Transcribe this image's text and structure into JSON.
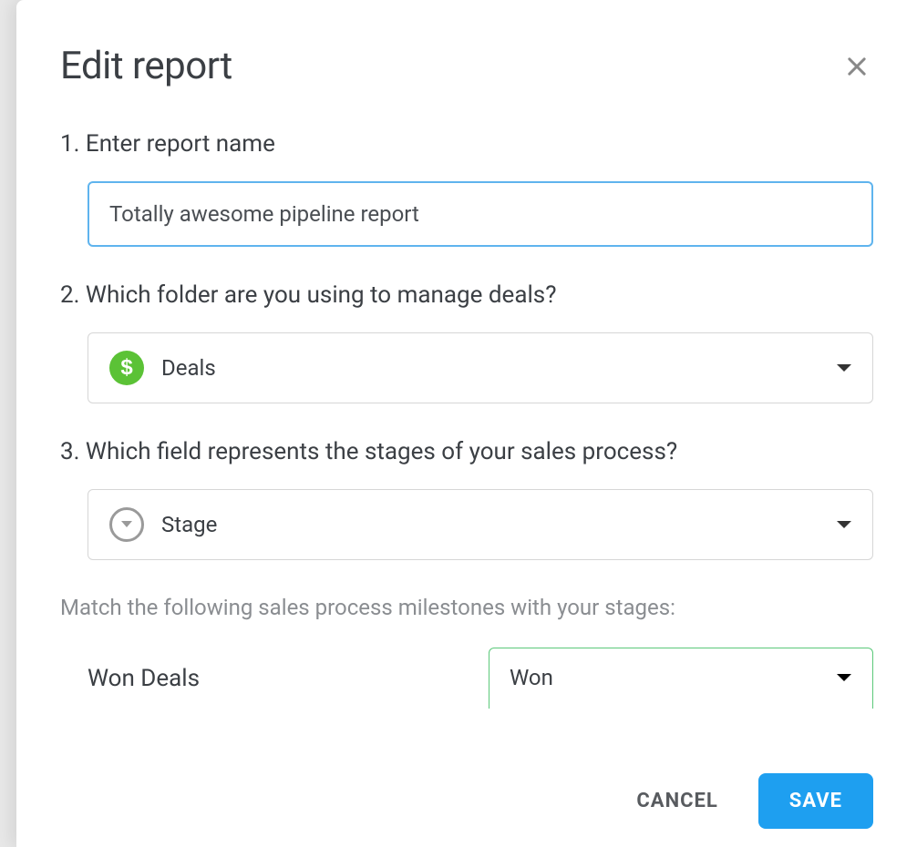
{
  "dialog": {
    "title": "Edit report"
  },
  "step1": {
    "label": "1. Enter report name",
    "input_value": "Totally awesome pipeline report"
  },
  "step2": {
    "label": "2. Which folder are you using to manage deals?",
    "selected": "Deals",
    "icon": "dollar-icon"
  },
  "step3": {
    "label": "3. Which field represents the stages of your sales process?",
    "selected": "Stage",
    "icon": "dropdown-circle-icon"
  },
  "match": {
    "helper": "Match the following sales process milestones with your stages:",
    "rows": [
      {
        "label": "Won Deals",
        "selected": "Won"
      }
    ]
  },
  "buttons": {
    "cancel": "CANCEL",
    "save": "SAVE"
  }
}
